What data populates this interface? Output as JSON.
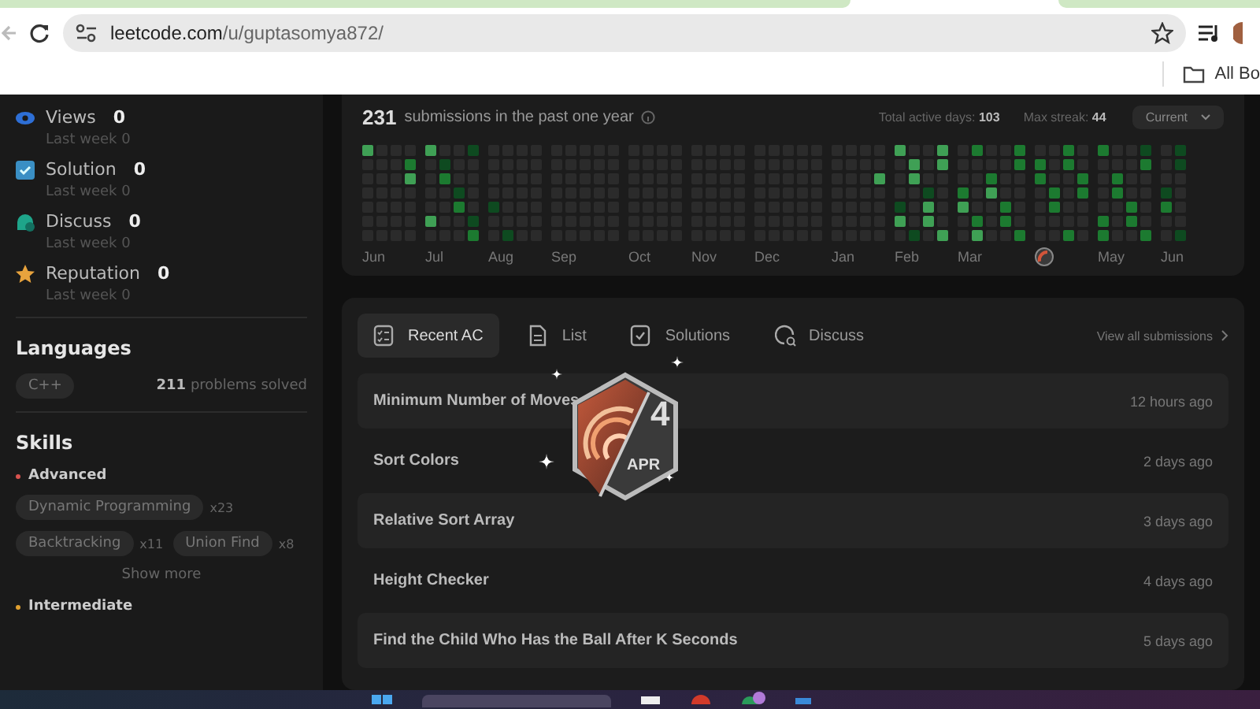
{
  "browser": {
    "url_host": "leetcode.com",
    "url_path": "/u/guptasomya872/",
    "bookmarks_label": "All Bo"
  },
  "community_stats": [
    {
      "kind": "views",
      "label": "Views",
      "value": "0",
      "sub_label": "Last week",
      "sub_value": "0"
    },
    {
      "kind": "solution",
      "label": "Solution",
      "value": "0",
      "sub_label": "Last week",
      "sub_value": "0"
    },
    {
      "kind": "discuss",
      "label": "Discuss",
      "value": "0",
      "sub_label": "Last week",
      "sub_value": "0"
    },
    {
      "kind": "reputation",
      "label": "Reputation",
      "value": "0",
      "sub_label": "Last week",
      "sub_value": "0"
    }
  ],
  "languages": {
    "title": "Languages",
    "items": [
      {
        "name": "C++",
        "count": "211",
        "suffix": "problems solved"
      }
    ]
  },
  "skills": {
    "title": "Skills",
    "groups": [
      {
        "level": "Advanced",
        "color": "#d9534f",
        "tags": [
          {
            "name": "Dynamic Programming",
            "count": "x23"
          },
          {
            "name": "Backtracking",
            "count": "x11"
          },
          {
            "name": "Union Find",
            "count": "x8"
          }
        ],
        "show_more": "Show more"
      },
      {
        "level": "Intermediate",
        "color": "#e0a030"
      }
    ]
  },
  "calendar": {
    "count": "231",
    "caption": "submissions in the past one year",
    "active_days_label": "Total active days:",
    "active_days": "103",
    "streak_label": "Max streak:",
    "streak": "44",
    "period": "Current",
    "months": [
      {
        "kind": "text",
        "label": "Jun"
      },
      {
        "kind": "text",
        "label": "Jul"
      },
      {
        "kind": "text",
        "label": "Aug"
      },
      {
        "kind": "text",
        "label": "Sep"
      },
      {
        "kind": "text",
        "label": "Oct"
      },
      {
        "kind": "text",
        "label": "Nov"
      },
      {
        "kind": "text",
        "label": "Dec"
      },
      {
        "kind": "text",
        "label": "Jan"
      },
      {
        "kind": "text",
        "label": "Feb"
      },
      {
        "kind": "text",
        "label": "Mar"
      },
      {
        "kind": "icon"
      },
      {
        "kind": "text",
        "label": "May"
      },
      {
        "kind": "text",
        "label": "Jun"
      }
    ]
  },
  "recent": {
    "tabs": [
      {
        "kind": "ac",
        "label": "Recent AC",
        "selected": true
      },
      {
        "kind": "list",
        "label": "List",
        "selected": false
      },
      {
        "kind": "solutions",
        "label": "Solutions",
        "selected": false
      },
      {
        "kind": "discuss",
        "label": "Discuss",
        "selected": false
      }
    ],
    "view_all": "View all submissions",
    "rows": [
      {
        "title": "Minimum Number of Moves",
        "time": "12 hours ago"
      },
      {
        "title": "Sort Colors",
        "time": "2 days ago"
      },
      {
        "title": "Relative Sort Array",
        "time": "3 days ago"
      },
      {
        "title": "Height Checker",
        "time": "4 days ago"
      },
      {
        "title": "Find the Child Who Has the Ball After K Seconds",
        "time": "5 days ago"
      }
    ]
  },
  "badge": {
    "day": "4",
    "month": "APR"
  }
}
